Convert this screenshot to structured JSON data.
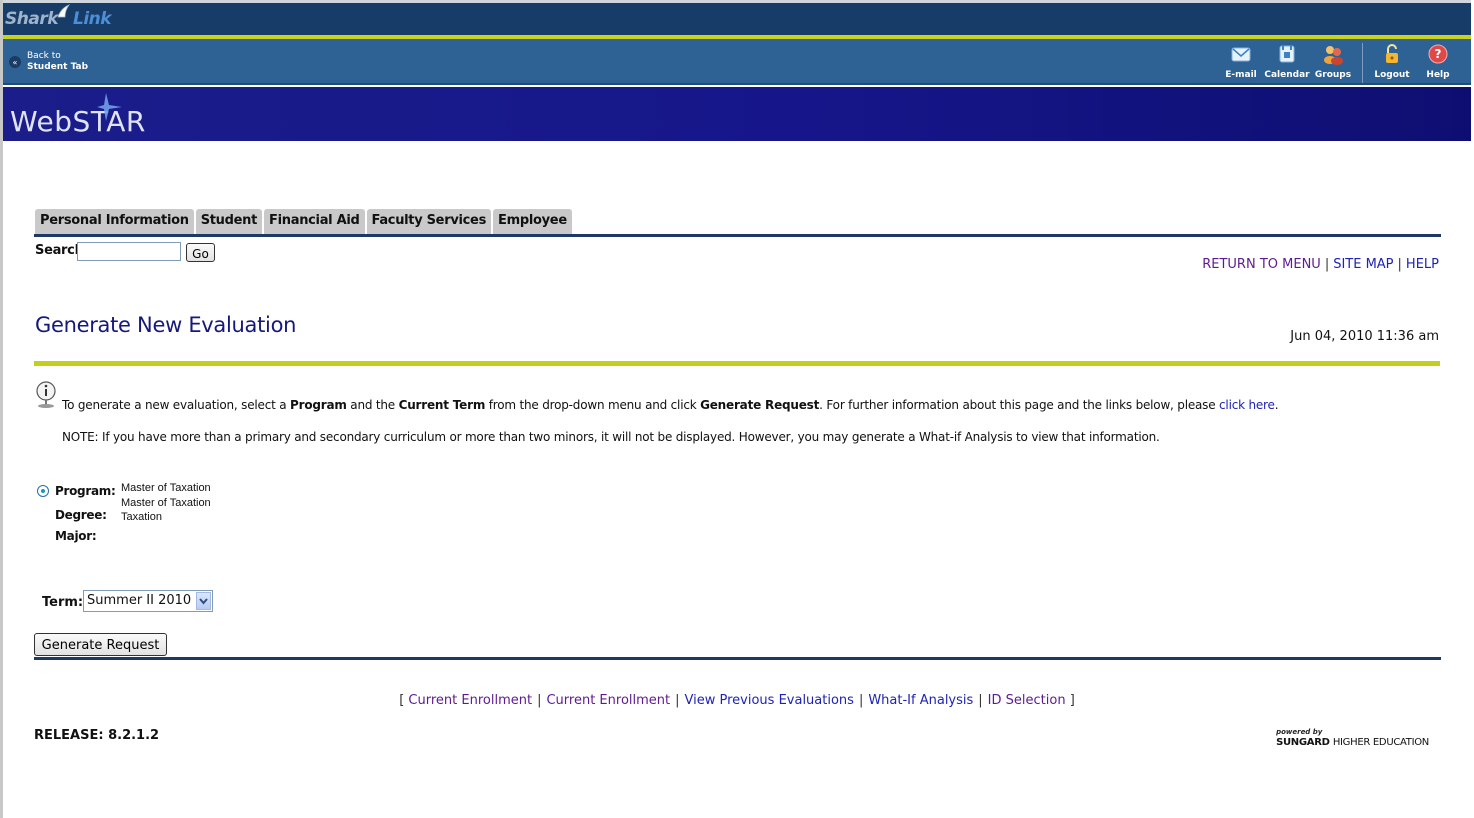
{
  "header": {
    "logo_part1": "Shark",
    "logo_part2": "Link",
    "back_line1": "Back to",
    "back_line2": "Student Tab",
    "tools": {
      "email": "E-mail",
      "calendar": "Calendar",
      "groups": "Groups",
      "logout": "Logout",
      "help": "Help"
    },
    "banner_title_a": "Web",
    "banner_title_b": "STAR"
  },
  "tabs": [
    "Personal Information",
    "Student",
    "Financial Aid",
    "Faculty Services",
    "Employee"
  ],
  "search": {
    "label": "Search",
    "value": "",
    "go_label": "Go"
  },
  "top_links": {
    "return_to_menu": "RETURN TO MENU",
    "site_map": "SITE MAP",
    "help": "HELP",
    "separator": "|"
  },
  "page": {
    "title": "Generate New Evaluation",
    "timestamp": "Jun 04, 2010 11:36 am"
  },
  "info": {
    "t1": "To generate a new evaluation, select a ",
    "b1": "Program",
    "t2": " and the ",
    "b2": "Current Term",
    "t3": " from the drop-down menu and click ",
    "b3": "Generate Request",
    "t4": ". For further information about this page and the links below, please ",
    "link": "click here",
    "t5": ".",
    "note": "NOTE: If you have more than a primary and secondary curriculum or more than two minors, it will not be displayed. However, you may generate a What-if Analysis to view that information."
  },
  "program": {
    "program_label": "Program:",
    "degree_label": "Degree:",
    "major_label": "Major:",
    "program_value": "Master of Taxation",
    "degree_value": "Master of Taxation",
    "major_value": "Taxation"
  },
  "term": {
    "label": "Term:",
    "selected": "Summer II 2010"
  },
  "generate_button": "Generate Request",
  "footer_links": {
    "open": "[",
    "close": "]",
    "sep": "|",
    "l1": "Current Enrollment",
    "l2": "Current Enrollment",
    "l3": "View Previous Evaluations",
    "l4": "What-If Analysis",
    "l5": "ID Selection"
  },
  "release": "RELEASE: 8.2.1.2",
  "powered": {
    "line1": "powered by",
    "brand": "SUNGARD",
    "suffix": "HIGHER EDUCATION"
  },
  "colors": {
    "top_bar": "#173c68",
    "nav_bar": "#2f6294",
    "banner": "#16168a",
    "accent_yellow": "#c4cf1c",
    "title_blue": "#14197b",
    "link_purple": "#5e1b91",
    "link_blue": "#1f23b5"
  },
  "icons": [
    "shark-fin-icon",
    "back-arrow-icon",
    "email-icon",
    "calendar-icon",
    "groups-icon",
    "logout-icon",
    "help-icon",
    "star-icon",
    "info-icon",
    "radio-selected-icon",
    "chevron-down-icon"
  ]
}
